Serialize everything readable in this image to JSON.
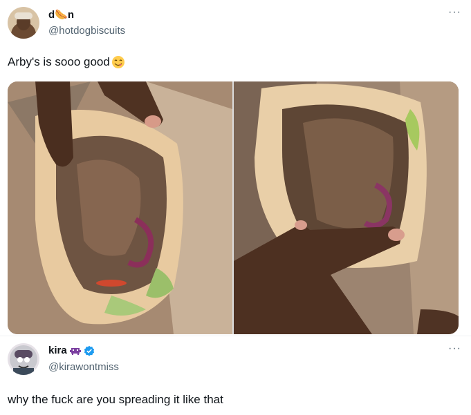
{
  "tweet": {
    "author": {
      "display_name": "d🌭n",
      "handle": "@hotdogbiscuits"
    },
    "text": "Arby's is sooo good",
    "emoji": "yum-face-emoji",
    "media": {
      "count": 2,
      "description": [
        "gyro-sandwich-photo-left",
        "gyro-sandwich-photo-right"
      ]
    }
  },
  "reply": {
    "author": {
      "display_name": "kira",
      "handle": "@kirawontmiss",
      "verified": true
    },
    "text": "why the fuck are you spreading it like that"
  },
  "colors": {
    "text": "#0f1419",
    "secondary": "#536471",
    "verified_blue": "#1d9bf0"
  }
}
